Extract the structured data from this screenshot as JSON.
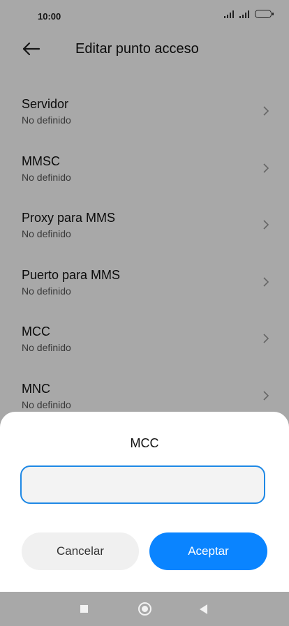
{
  "status_bar": {
    "time": "10:00",
    "icons": [
      "signal-icon",
      "signal-icon",
      "battery-icon"
    ]
  },
  "header": {
    "back_icon": "arrow-left-icon",
    "title": "Editar punto acceso"
  },
  "settings": {
    "items": [
      {
        "title": "Servidor",
        "value": "No definido"
      },
      {
        "title": "MMSC",
        "value": "No definido"
      },
      {
        "title": "Proxy para MMS",
        "value": "No definido"
      },
      {
        "title": "Puerto para MMS",
        "value": "No definido"
      },
      {
        "title": "MCC",
        "value": "No definido"
      },
      {
        "title": "MNC",
        "value": "No definido"
      }
    ]
  },
  "dialog": {
    "title": "MCC",
    "input_value": "",
    "cancel_label": "Cancelar",
    "accept_label": "Aceptar"
  },
  "nav_bar": {
    "icons": [
      "recent-apps-icon",
      "home-icon",
      "back-icon"
    ]
  },
  "colors": {
    "accent": "#0a84ff",
    "input_border": "#1e88e5",
    "overlay": "rgba(0,0,0,0.34)",
    "nav_bar": "#a8a8a8"
  }
}
